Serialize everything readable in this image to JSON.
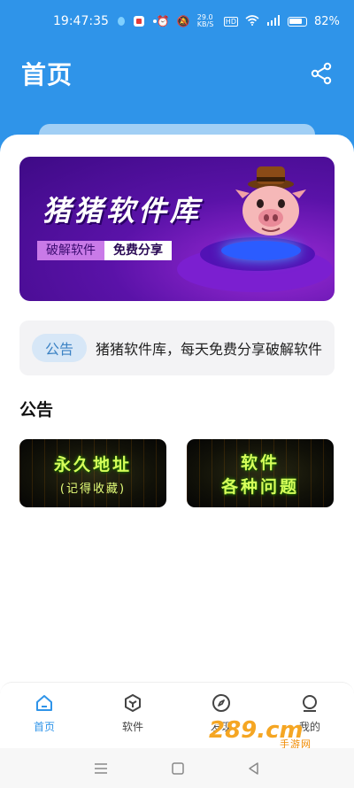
{
  "status_bar": {
    "time": "19:47:35",
    "network_speed": "29.0\nKB/S",
    "battery": "82%"
  },
  "header": {
    "title": "首页",
    "share_icon": "share-icon"
  },
  "banner": {
    "title": "猪猪软件库",
    "tag_left": "破解软件",
    "tag_right": "免费分享",
    "mascot": "pig-mascot"
  },
  "notice": {
    "chip": "公告",
    "text": "猪猪软件库，每天免费分享破解软件"
  },
  "section": {
    "title": "公告"
  },
  "tiles": [
    {
      "line1": "永久地址",
      "line2": "(记得收藏)"
    },
    {
      "line1": "软件",
      "line2": "各种问题"
    }
  ],
  "bottom_nav": {
    "items": [
      {
        "label": "首页",
        "icon": "home-icon",
        "active": true
      },
      {
        "label": "软件",
        "icon": "cube-icon",
        "active": false
      },
      {
        "label": "发现",
        "icon": "compass-icon",
        "active": false
      },
      {
        "label": "我的",
        "icon": "profile-icon",
        "active": false
      }
    ]
  },
  "watermark": {
    "brand": "289.cm",
    "sub": "手游网"
  },
  "colors": {
    "primary": "#2f94e9",
    "banner_purple": "#5a12a8",
    "tile_text": "#d6ff5a"
  }
}
